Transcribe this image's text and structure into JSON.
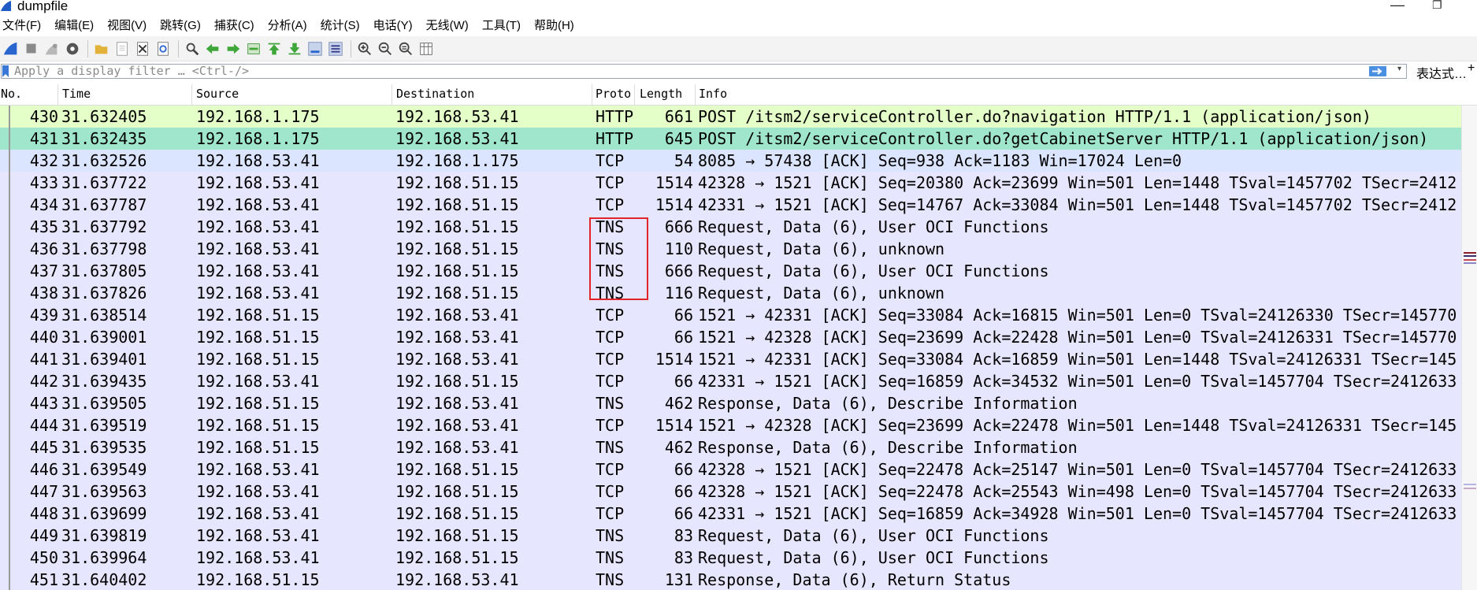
{
  "window": {
    "title": "dumpfile",
    "minimize_glyph": "—",
    "restore_glyph": "❐"
  },
  "menu": [
    "文件(F)",
    "编辑(E)",
    "视图(V)",
    "跳转(G)",
    "捕获(C)",
    "分析(A)",
    "统计(S)",
    "电话(Y)",
    "无线(W)",
    "工具(T)",
    "帮助(H)"
  ],
  "toolbar": {
    "icons": [
      "shark-fin-start-icon",
      "stop-capture-icon",
      "restart-capture-icon",
      "capture-options-icon",
      "sep",
      "open-file-icon",
      "save-file-icon",
      "close-file-icon",
      "reload-file-icon",
      "sep",
      "find-packet-icon",
      "go-back-icon",
      "go-forward-icon",
      "go-to-packet-icon",
      "go-first-icon",
      "go-last-icon",
      "auto-scroll-icon",
      "colorize-icon",
      "sep",
      "zoom-in-icon",
      "zoom-out-icon",
      "zoom-normal-icon",
      "resize-columns-icon"
    ]
  },
  "filter": {
    "placeholder": "Apply a display filter … <Ctrl-/>",
    "expression_label": "表达式…",
    "more_glyph": "+"
  },
  "columns": {
    "no": "No.",
    "time": "Time",
    "source": "Source",
    "destination": "Destination",
    "protocol": "Proto",
    "length": "Length",
    "info": "Info"
  },
  "colors": {
    "http_selected_bg": "#e4ffc7",
    "http_bg": "#a0e6cc",
    "tcp_light_bg": "#dce5ff",
    "tcp_bg": "#e7e6ff",
    "highlight_box": "#e3242b"
  },
  "highlight_box": {
    "label": "TNS rows 435-438 boxed in red"
  },
  "packets": [
    {
      "no": "430",
      "time": "31.632405",
      "src": "192.168.1.175",
      "dst": "192.168.53.41",
      "proto": "HTTP",
      "len": "661",
      "info": "POST /itsm2/serviceController.do?navigation HTTP/1.1  (application/json)",
      "bg": "#e4ffc7"
    },
    {
      "no": "431",
      "time": "31.632435",
      "src": "192.168.1.175",
      "dst": "192.168.53.41",
      "proto": "HTTP",
      "len": "645",
      "info": "POST /itsm2/serviceController.do?getCabinetServer HTTP/1.1  (application/json)",
      "bg": "#a0e6cc"
    },
    {
      "no": "432",
      "time": "31.632526",
      "src": "192.168.53.41",
      "dst": "192.168.1.175",
      "proto": "TCP",
      "len": "54",
      "info": "8085 → 57438 [ACK] Seq=938 Ack=1183 Win=17024 Len=0",
      "bg": "#dce5ff"
    },
    {
      "no": "433",
      "time": "31.637722",
      "src": "192.168.53.41",
      "dst": "192.168.51.15",
      "proto": "TCP",
      "len": "1514",
      "info": "42328 → 1521 [ACK] Seq=20380 Ack=23699 Win=501 Len=1448 TSval=1457702 TSecr=2412",
      "bg": "#e7e6ff"
    },
    {
      "no": "434",
      "time": "31.637787",
      "src": "192.168.53.41",
      "dst": "192.168.51.15",
      "proto": "TCP",
      "len": "1514",
      "info": "42331 → 1521 [ACK] Seq=14767 Ack=33084 Win=501 Len=1448 TSval=1457702 TSecr=2412",
      "bg": "#e7e6ff"
    },
    {
      "no": "435",
      "time": "31.637792",
      "src": "192.168.53.41",
      "dst": "192.168.51.15",
      "proto": "TNS",
      "len": "666",
      "info": "Request, Data (6), User OCI Functions",
      "bg": "#e7e6ff"
    },
    {
      "no": "436",
      "time": "31.637798",
      "src": "192.168.53.41",
      "dst": "192.168.51.15",
      "proto": "TNS",
      "len": "110",
      "info": "Request, Data (6), unknown",
      "bg": "#e7e6ff"
    },
    {
      "no": "437",
      "time": "31.637805",
      "src": "192.168.53.41",
      "dst": "192.168.51.15",
      "proto": "TNS",
      "len": "666",
      "info": "Request, Data (6), User OCI Functions",
      "bg": "#e7e6ff"
    },
    {
      "no": "438",
      "time": "31.637826",
      "src": "192.168.53.41",
      "dst": "192.168.51.15",
      "proto": "TNS",
      "len": "116",
      "info": "Request, Data (6), unknown",
      "bg": "#e7e6ff"
    },
    {
      "no": "439",
      "time": "31.638514",
      "src": "192.168.51.15",
      "dst": "192.168.53.41",
      "proto": "TCP",
      "len": "66",
      "info": "1521 → 42331 [ACK] Seq=33084 Ack=16815 Win=501 Len=0 TSval=24126330 TSecr=145770",
      "bg": "#e7e6ff"
    },
    {
      "no": "440",
      "time": "31.639001",
      "src": "192.168.51.15",
      "dst": "192.168.53.41",
      "proto": "TCP",
      "len": "66",
      "info": "1521 → 42328 [ACK] Seq=23699 Ack=22428 Win=501 Len=0 TSval=24126331 TSecr=145770",
      "bg": "#e7e6ff"
    },
    {
      "no": "441",
      "time": "31.639401",
      "src": "192.168.51.15",
      "dst": "192.168.53.41",
      "proto": "TCP",
      "len": "1514",
      "info": "1521 → 42331 [ACK] Seq=33084 Ack=16859 Win=501 Len=1448 TSval=24126331 TSecr=145",
      "bg": "#e7e6ff"
    },
    {
      "no": "442",
      "time": "31.639435",
      "src": "192.168.53.41",
      "dst": "192.168.51.15",
      "proto": "TCP",
      "len": "66",
      "info": "42331 → 1521 [ACK] Seq=16859 Ack=34532 Win=501 Len=0 TSval=1457704 TSecr=2412633",
      "bg": "#e7e6ff"
    },
    {
      "no": "443",
      "time": "31.639505",
      "src": "192.168.51.15",
      "dst": "192.168.53.41",
      "proto": "TNS",
      "len": "462",
      "info": "Response, Data (6), Describe Information",
      "bg": "#e7e6ff"
    },
    {
      "no": "444",
      "time": "31.639519",
      "src": "192.168.51.15",
      "dst": "192.168.53.41",
      "proto": "TCP",
      "len": "1514",
      "info": "1521 → 42328 [ACK] Seq=23699 Ack=22478 Win=501 Len=1448 TSval=24126331 TSecr=145",
      "bg": "#e7e6ff"
    },
    {
      "no": "445",
      "time": "31.639535",
      "src": "192.168.51.15",
      "dst": "192.168.53.41",
      "proto": "TNS",
      "len": "462",
      "info": "Response, Data (6), Describe Information",
      "bg": "#e7e6ff"
    },
    {
      "no": "446",
      "time": "31.639549",
      "src": "192.168.53.41",
      "dst": "192.168.51.15",
      "proto": "TCP",
      "len": "66",
      "info": "42328 → 1521 [ACK] Seq=22478 Ack=25147 Win=501 Len=0 TSval=1457704 TSecr=2412633",
      "bg": "#e7e6ff"
    },
    {
      "no": "447",
      "time": "31.639563",
      "src": "192.168.53.41",
      "dst": "192.168.51.15",
      "proto": "TCP",
      "len": "66",
      "info": "42328 → 1521 [ACK] Seq=22478 Ack=25543 Win=498 Len=0 TSval=1457704 TSecr=2412633",
      "bg": "#e7e6ff"
    },
    {
      "no": "448",
      "time": "31.639699",
      "src": "192.168.53.41",
      "dst": "192.168.51.15",
      "proto": "TCP",
      "len": "66",
      "info": "42331 → 1521 [ACK] Seq=16859 Ack=34928 Win=501 Len=0 TSval=1457704 TSecr=2412633",
      "bg": "#e7e6ff"
    },
    {
      "no": "449",
      "time": "31.639819",
      "src": "192.168.53.41",
      "dst": "192.168.51.15",
      "proto": "TNS",
      "len": "83",
      "info": "Request, Data (6), User OCI Functions",
      "bg": "#e7e6ff"
    },
    {
      "no": "450",
      "time": "31.639964",
      "src": "192.168.53.41",
      "dst": "192.168.51.15",
      "proto": "TNS",
      "len": "83",
      "info": "Request, Data (6), User OCI Functions",
      "bg": "#e7e6ff"
    },
    {
      "no": "451",
      "time": "31.640402",
      "src": "192.168.51.15",
      "dst": "192.168.53.41",
      "proto": "TNS",
      "len": "131",
      "info": "Response, Data (6), Return Status",
      "bg": "#e7e6ff"
    }
  ]
}
